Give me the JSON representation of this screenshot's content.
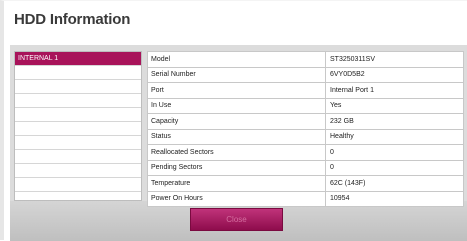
{
  "dialog": {
    "title": "HDD Information",
    "close_label": "Close"
  },
  "drives": [
    {
      "label": "INTERNAL 1",
      "selected": true
    },
    {
      "label": "",
      "selected": false
    },
    {
      "label": "",
      "selected": false
    },
    {
      "label": "",
      "selected": false
    },
    {
      "label": "",
      "selected": false
    },
    {
      "label": "",
      "selected": false
    },
    {
      "label": "",
      "selected": false
    },
    {
      "label": "",
      "selected": false
    },
    {
      "label": "",
      "selected": false
    },
    {
      "label": "",
      "selected": false
    }
  ],
  "info": [
    {
      "label": "Model",
      "value": "ST3250311SV"
    },
    {
      "label": "Serial Number",
      "value": "6VY0D5B2"
    },
    {
      "label": "Port",
      "value": "Internal Port 1"
    },
    {
      "label": "In Use",
      "value": "Yes"
    },
    {
      "label": "Capacity",
      "value": "232 GB"
    },
    {
      "label": "Status",
      "value": "Healthy"
    },
    {
      "label": "Reallocated Sectors",
      "value": "0"
    },
    {
      "label": "Pending Sectors",
      "value": "0"
    },
    {
      "label": "Temperature",
      "value": "62C (143F)"
    },
    {
      "label": "Power On Hours",
      "value": "10954"
    }
  ],
  "colors": {
    "accent": "#a8135a",
    "button": "#9e1a5c"
  }
}
